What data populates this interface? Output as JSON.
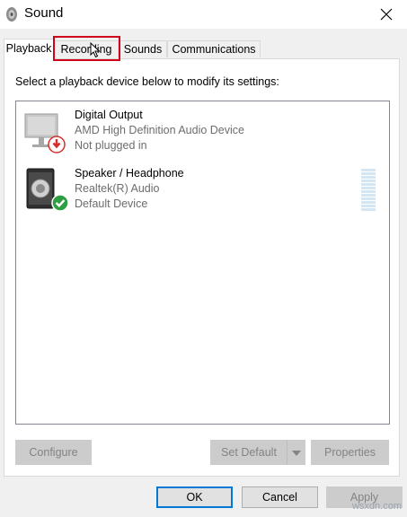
{
  "window": {
    "title": "Sound",
    "icons": {
      "app": "speaker-app-icon",
      "close": "close-icon"
    }
  },
  "tabs": [
    {
      "label": "Playback",
      "selected": true
    },
    {
      "label": "Recording",
      "selected": false
    },
    {
      "label": "Sounds",
      "selected": false
    },
    {
      "label": "Communications",
      "selected": false
    }
  ],
  "instruction": "Select a playback device below to modify its settings:",
  "devices": [
    {
      "name": "Digital Output",
      "driver": "AMD High Definition Audio Device",
      "status": "Not plugged in",
      "icon": "monitor-speaker-icon",
      "badge": "unplugged-down-arrow-badge",
      "badge_color": "#d62e2e"
    },
    {
      "name": "Speaker / Headphone",
      "driver": "Realtek(R) Audio",
      "status": "Default Device",
      "icon": "speaker-icon",
      "badge": "default-check-badge",
      "badge_color": "#2e9e40",
      "level": 0
    }
  ],
  "buttons": {
    "configure": "Configure",
    "set_default": "Set Default",
    "properties": "Properties",
    "ok": "OK",
    "cancel": "Cancel",
    "apply": "Apply"
  },
  "colors": {
    "highlight_box": "#d0021b",
    "ok_focus_border": "#0078d7",
    "disabled_text": "#838383"
  },
  "watermark": "wsxdn.com"
}
